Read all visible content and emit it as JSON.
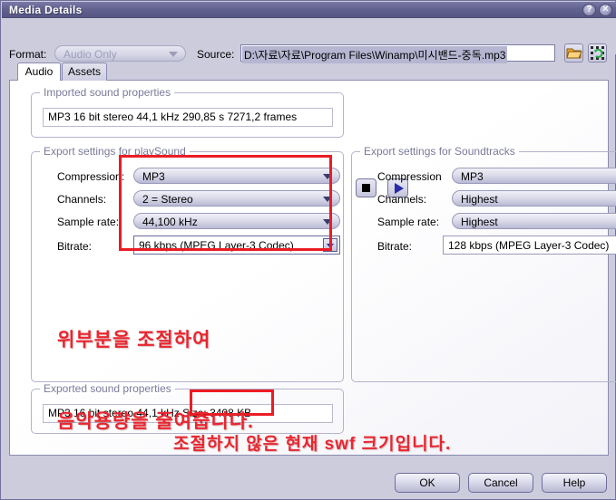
{
  "window": {
    "title": "Media Details",
    "help_button": "?",
    "close_button": "✕"
  },
  "topbar": {
    "format_label": "Format:",
    "format_value": "Audio Only",
    "source_label": "Source:",
    "source_value": "D:\\자료\\자료\\Program Files\\Winamp\\미시밴드-중독.mp3",
    "browse_icon": "folder-open-icon",
    "symbol_icon": "symbol-swap-icon"
  },
  "tabs": [
    {
      "label": "Audio",
      "active": true
    },
    {
      "label": "Assets",
      "active": false
    }
  ],
  "imported": {
    "group_title": "Imported sound properties",
    "value": "MP3 16 bit stereo   44,1 kHz 290,85 s 7271,2 frames"
  },
  "transport": {
    "stop_icon": "stop-icon",
    "play_icon": "play-icon"
  },
  "playsound": {
    "group_title": "Export settings for playSound",
    "rows": [
      {
        "label": "Compression:",
        "value": "MP3"
      },
      {
        "label": "Channels:",
        "value": "2 = Stereo"
      },
      {
        "label": "Sample rate:",
        "value": "44,100 kHz"
      },
      {
        "label": "Bitrate:",
        "value": "96 kbps (MPEG Layer-3 Codec)"
      }
    ]
  },
  "soundtracks": {
    "group_title": "Export settings for Soundtracks",
    "rows": [
      {
        "label": "Compression",
        "value": "MP3"
      },
      {
        "label": "Channels:",
        "value": "Highest"
      },
      {
        "label": "Sample rate:",
        "value": "Highest"
      },
      {
        "label": "Bitrate:",
        "value": "128 kbps (MPEG Layer-3 Codec)"
      }
    ]
  },
  "exported": {
    "group_title": "Exported sound properties",
    "value": "MP3 16 bit stereo   44,1 kHz  Size: 3408 KB"
  },
  "annotations": {
    "note_1_line_1": "위부분을 조절하여",
    "note_1_line_2": "음악용량을 줄여줍니다.",
    "note_2": "조절하지 않은 현재 swf 크기입니다.",
    "highlight_color": "#ec1c24"
  },
  "footer": {
    "ok": "OK",
    "cancel": "Cancel",
    "help": "Help"
  }
}
